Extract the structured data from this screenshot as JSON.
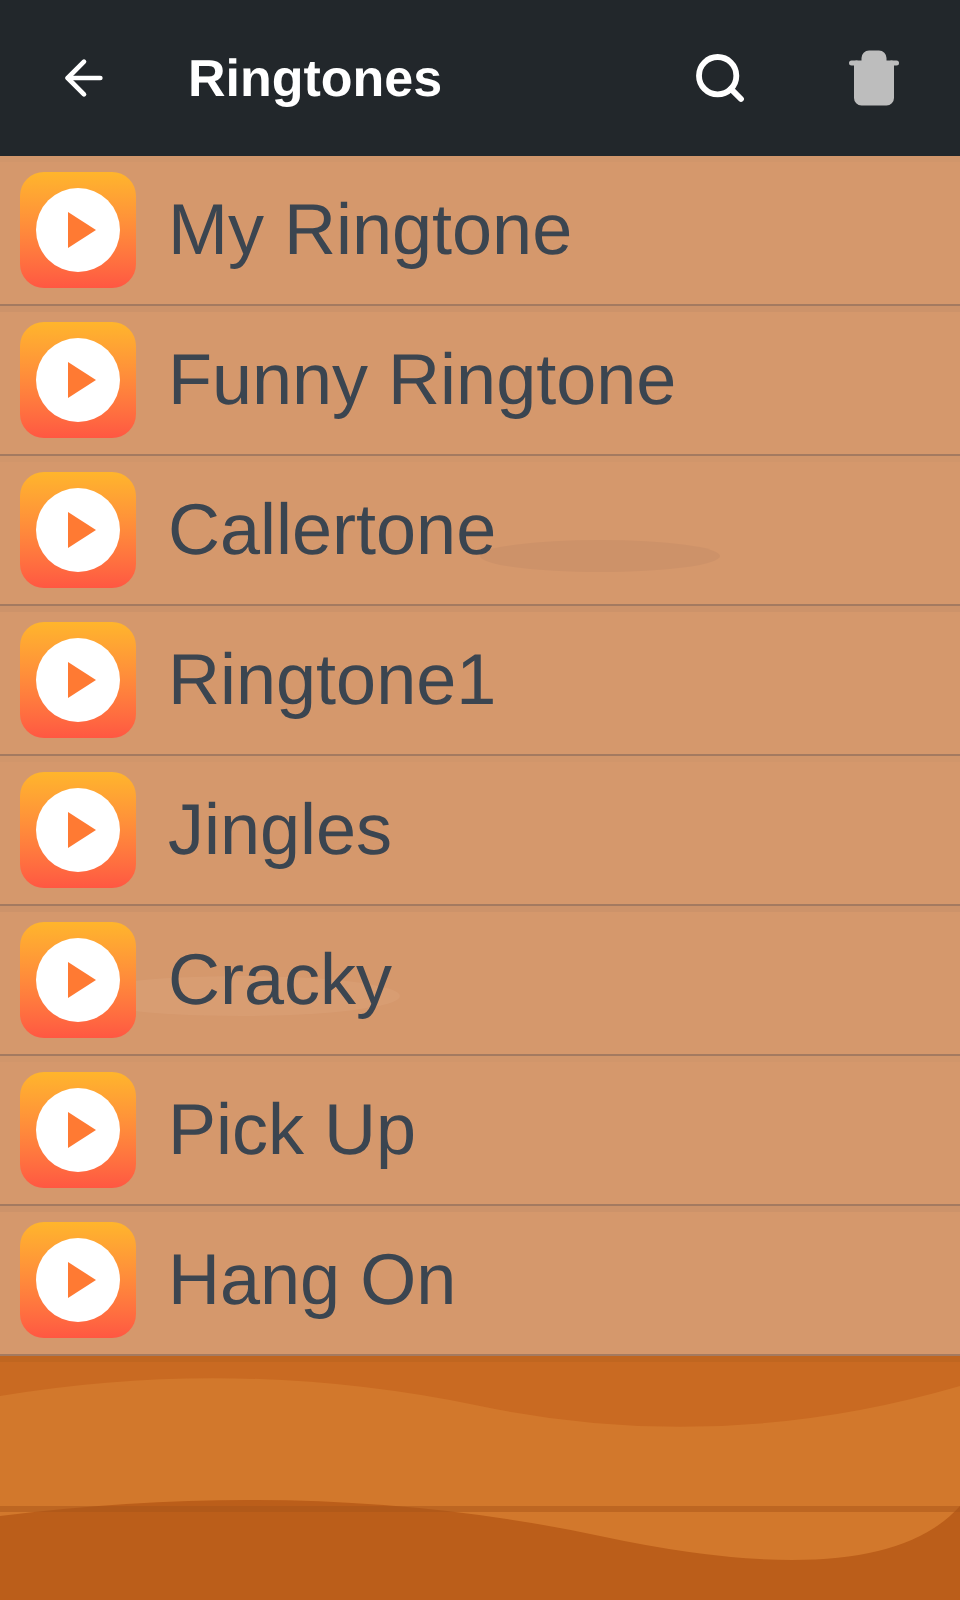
{
  "toolbar": {
    "title": "Ringtones"
  },
  "ringtones": [
    {
      "name": "My Ringtone"
    },
    {
      "name": "Funny Ringtone"
    },
    {
      "name": "Callertone"
    },
    {
      "name": "Ringtone1"
    },
    {
      "name": "Jingles"
    },
    {
      "name": "Cracky"
    },
    {
      "name": "Pick Up"
    },
    {
      "name": "Hang On"
    }
  ]
}
